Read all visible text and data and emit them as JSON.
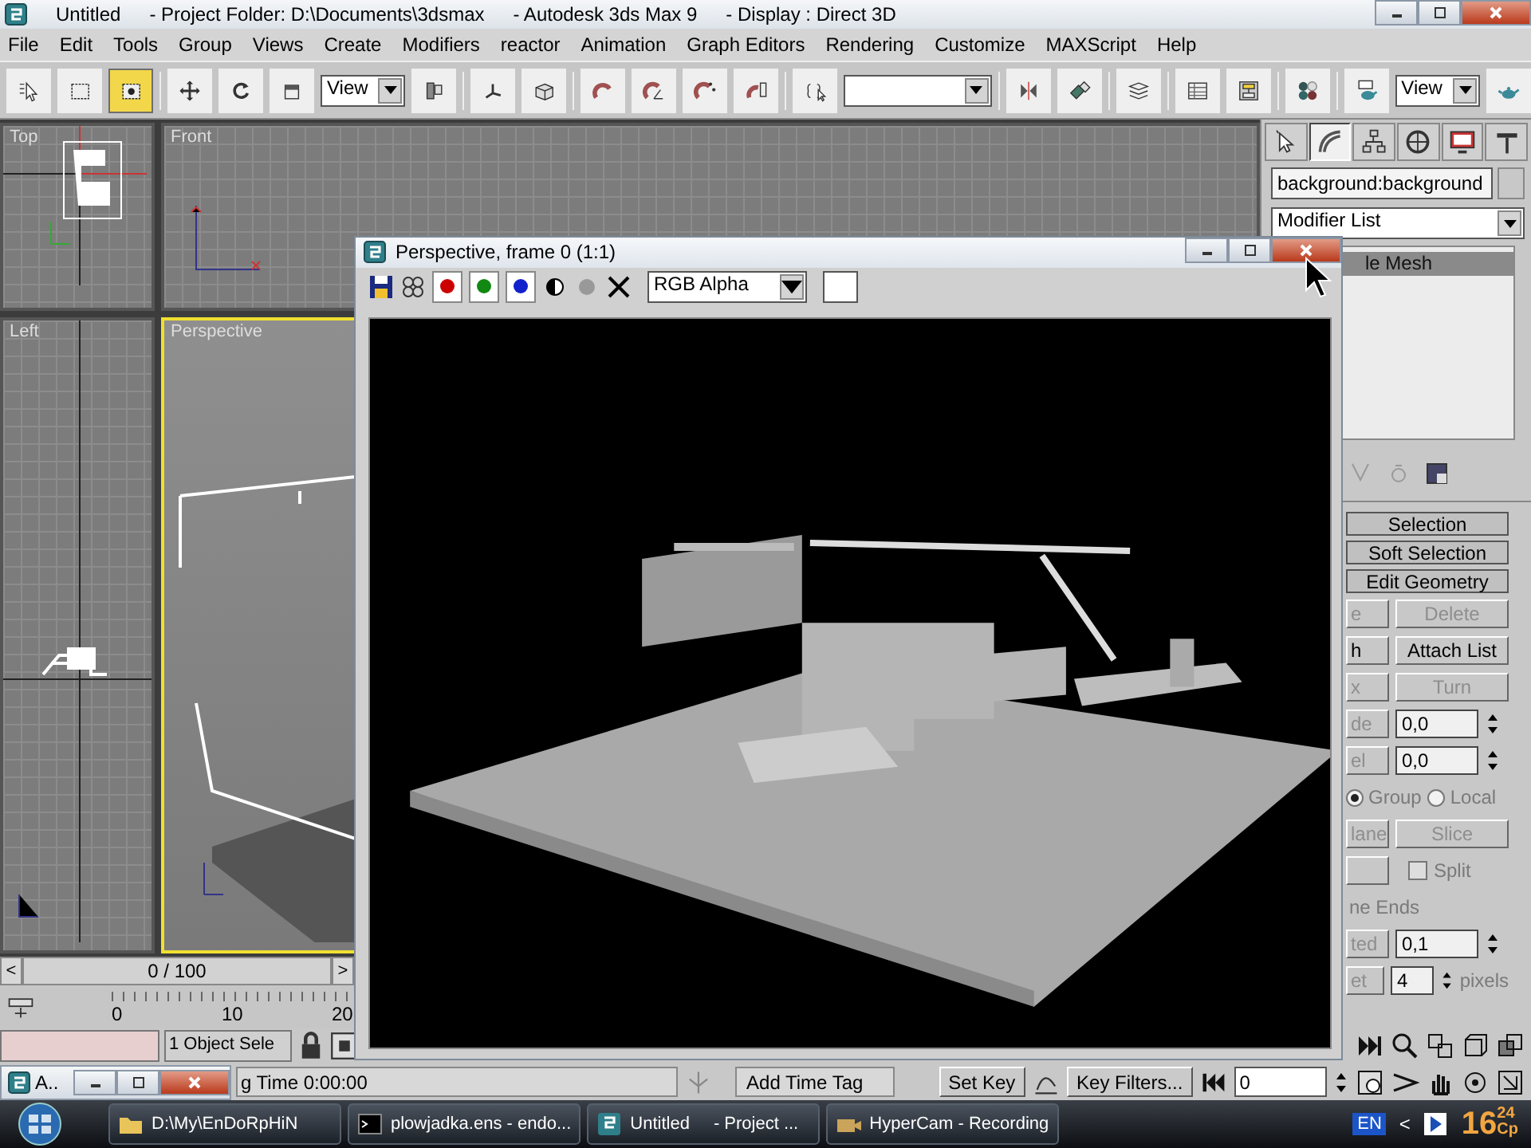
{
  "window": {
    "title": [
      "Untitled",
      "- Project Folder: D:\\Documents\\3dsmax",
      "- Autodesk 3ds Max 9",
      "- Display : Direct 3D"
    ]
  },
  "menu": [
    "File",
    "Edit",
    "Tools",
    "Group",
    "Views",
    "Create",
    "Modifiers",
    "reactor",
    "Animation",
    "Graph Editors",
    "Rendering",
    "Customize",
    "MAXScript",
    "Help"
  ],
  "toolbar": [
    {
      "kind": "button",
      "selected": false
    },
    {
      "kind": "button",
      "selected": false
    },
    {
      "kind": "button",
      "selected": true
    },
    {
      "kind": "separator"
    },
    {
      "kind": "button",
      "selected": false
    },
    {
      "kind": "button",
      "selected": false
    },
    {
      "kind": "button",
      "selected": false
    },
    {
      "kind": "dropdown",
      "value": "View"
    },
    {
      "kind": "button",
      "selected": false
    },
    {
      "kind": "separator"
    },
    {
      "kind": "button",
      "selected": false
    },
    {
      "kind": "button",
      "selected": false
    },
    {
      "kind": "separator"
    },
    {
      "kind": "button",
      "selected": false
    },
    {
      "kind": "button",
      "selected": false
    },
    {
      "kind": "button",
      "selected": false
    },
    {
      "kind": "button",
      "selected": false
    },
    {
      "kind": "separator"
    },
    {
      "kind": "button",
      "selected": false
    },
    {
      "kind": "dropdown"
    },
    {
      "kind": "separator"
    },
    {
      "kind": "button",
      "selected": false
    },
    {
      "kind": "button",
      "selected": false
    },
    {
      "kind": "separator"
    },
    {
      "kind": "button",
      "selected": false
    },
    {
      "kind": "separator"
    },
    {
      "kind": "button",
      "selected": false
    },
    {
      "kind": "button",
      "selected": false
    },
    {
      "kind": "separator"
    },
    {
      "kind": "button",
      "selected": false
    },
    {
      "kind": "separator"
    },
    {
      "kind": "button",
      "selected": false
    },
    {
      "kind": "dropdown",
      "value": "View"
    },
    {
      "kind": "button",
      "selected": false
    }
  ],
  "viewports": [
    {
      "label": "Top",
      "kind": "top",
      "active": false
    },
    {
      "label": "Front",
      "kind": "front",
      "active": false
    },
    {
      "label": "Left",
      "kind": "left",
      "active": false
    },
    {
      "label": "Perspective",
      "kind": "perspective",
      "active": true
    }
  ],
  "time_slider": {
    "prev": "<",
    "label": "0 / 100",
    "next": ">",
    "level": 0
  },
  "track_bar": {
    "ticks": [
      "0",
      "10",
      "20"
    ]
  },
  "command_panel": {
    "tabs": [
      {
        "selected": false
      },
      {
        "selected": true
      },
      {
        "selected": false
      },
      {
        "selected": false
      },
      {
        "selected": false
      },
      {
        "selected": false
      }
    ],
    "object_name": "background:background",
    "modifier_list": "Modifier List",
    "stack": [
      {
        "label": "le Mesh",
        "selected": true
      }
    ],
    "rollouts": [
      "Selection",
      "Soft Selection",
      "Edit Geometry"
    ],
    "rows": [
      {
        "kind": "buttons",
        "items": [
          {
            "label": "e",
            "disabled": true
          },
          {
            "label": "Delete",
            "disabled": true
          }
        ]
      },
      {
        "kind": "buttons",
        "items": [
          {
            "label": "h",
            "disabled": false
          },
          {
            "label": "Attach List",
            "disabled": false
          }
        ]
      },
      {
        "kind": "buttons",
        "items": [
          {
            "label": "x",
            "disabled": true
          },
          {
            "label": "Turn",
            "disabled": true
          }
        ]
      },
      {
        "kind": "spinner",
        "label": "de",
        "value": "0,0"
      },
      {
        "kind": "spinner",
        "label": "el",
        "value": "0,0"
      },
      {
        "kind": "radios",
        "items": [
          {
            "label": "Group",
            "selected": true
          },
          {
            "label": "Local",
            "selected": false
          }
        ]
      },
      {
        "kind": "buttons",
        "items": [
          {
            "label": "lane",
            "disabled": true
          },
          {
            "label": "Slice",
            "disabled": true
          }
        ]
      },
      {
        "kind": "check",
        "label": "Split",
        "checked": false
      },
      {
        "kind": "note",
        "text": "ne Ends"
      },
      {
        "kind": "spinner",
        "label": "ted",
        "value": "0,1"
      },
      {
        "kind": "spinner",
        "label": "et",
        "value": "4",
        "unit": "pixels"
      }
    ]
  },
  "status": {
    "selection": "1 Object Sele",
    "time": "g Time 0:00:00",
    "time_tag": "Add Time Tag",
    "set_key": "Set Key",
    "key_filters": "Key Filters...",
    "frame": "0"
  },
  "render_window": {
    "title": "Perspective, frame 0 (1:1)",
    "channels": [
      {
        "color": "#cc0000",
        "on": true
      },
      {
        "color": "#118811",
        "on": true
      },
      {
        "color": "#1122cc",
        "on": true
      }
    ],
    "channel_dropdown": "RGB Alpha"
  },
  "minimized_window": {
    "title": "A.."
  },
  "taskbar": {
    "items": [
      {
        "kind": "folder",
        "label": "D:\\My\\EnDoRpHiN"
      },
      {
        "kind": "console",
        "label": "plowjadka.ens - endo..."
      },
      {
        "kind": "app",
        "label": "Untitled",
        "detail": "- Project ..."
      },
      {
        "kind": "camera",
        "label": "HyperCam - Recording"
      }
    ],
    "language": "EN",
    "arrow": "<",
    "hour": "16",
    "minute": "24",
    "day": "Cp"
  }
}
